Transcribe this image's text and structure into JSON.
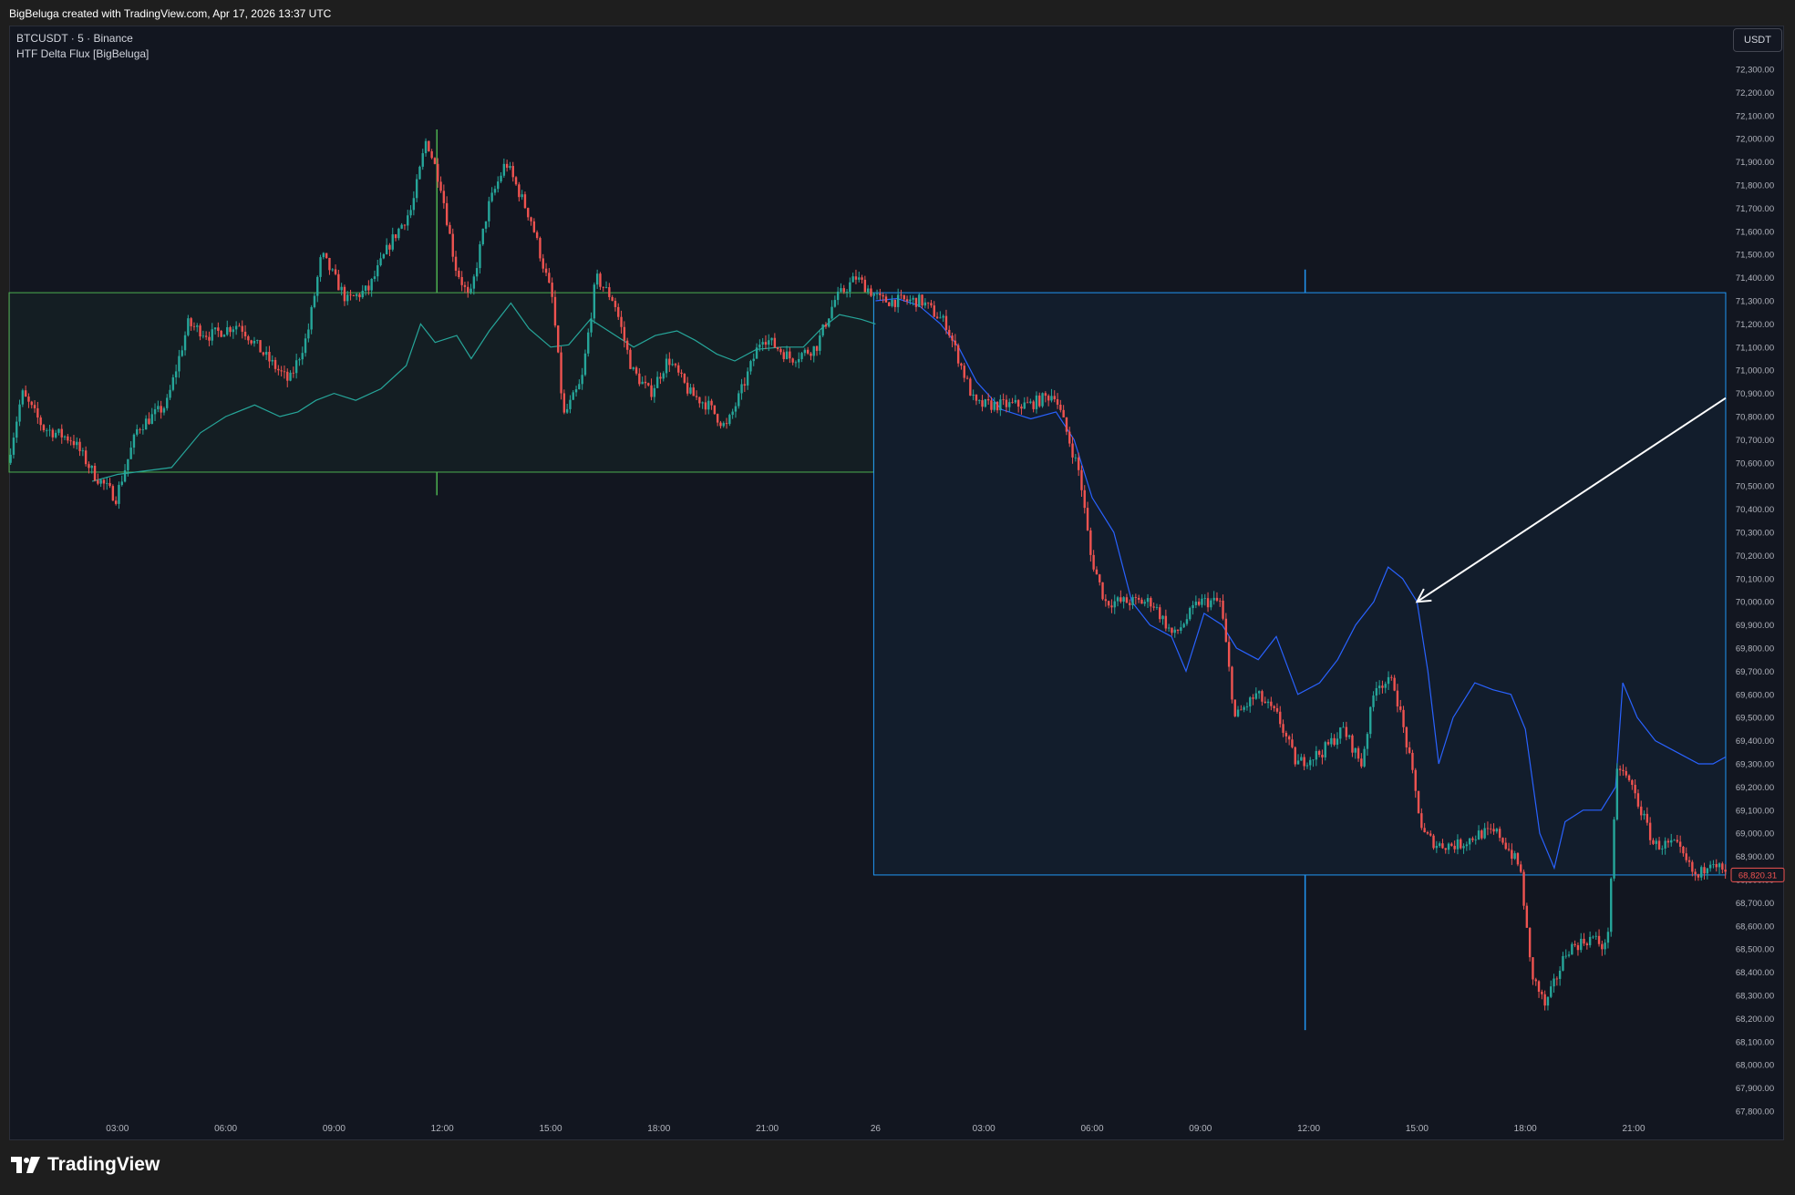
{
  "header": {
    "attribution": "BigBeluga created with TradingView.com, Apr 17, 2026 13:37 UTC"
  },
  "legend": {
    "symbol_line": "BTCUSDT · 5 · Binance",
    "indicator_line": "HTF Delta Flux [BigBeluga]"
  },
  "price_scale": {
    "unit_button": "USDT",
    "last_price_label": "68,820.31"
  },
  "footer": {
    "brand": "TradingView"
  },
  "colors": {
    "background": "#121620",
    "up_candle": "#26a69a",
    "down_candle": "#ef5350",
    "green_box": "#4caf50",
    "blue_box": "#2196f3",
    "delta_line_green": "#26a69a",
    "delta_line_blue": "#2962ff",
    "arrow": "#ffffff",
    "last_price": "#ef5350"
  },
  "chart_data": {
    "type": "candlestick",
    "symbol": "BTCUSDT",
    "interval": "5",
    "exchange": "Binance",
    "ylim": [
      67800,
      72300
    ],
    "y_ticks": [
      "72,300.00",
      "72,200.00",
      "72,100.00",
      "72,000.00",
      "71,900.00",
      "71,800.00",
      "71,700.00",
      "71,600.00",
      "71,500.00",
      "71,400.00",
      "71,300.00",
      "71,200.00",
      "71,100.00",
      "71,000.00",
      "70,900.00",
      "70,800.00",
      "70,700.00",
      "70,600.00",
      "70,500.00",
      "70,400.00",
      "70,300.00",
      "70,200.00",
      "70,100.00",
      "70,000.00",
      "69,900.00",
      "69,800.00",
      "69,700.00",
      "69,600.00",
      "69,500.00",
      "69,400.00",
      "69,300.00",
      "69,200.00",
      "69,100.00",
      "69,000.00",
      "68,900.00",
      "68,800.00",
      "68,700.00",
      "68,600.00",
      "68,500.00",
      "68,400.00",
      "68,300.00",
      "68,200.00",
      "68,100.00",
      "68,000.00",
      "67,900.00",
      "67,800.00"
    ],
    "x_ticks": [
      {
        "label": "03:00",
        "hours": 3
      },
      {
        "label": "06:00",
        "hours": 6
      },
      {
        "label": "09:00",
        "hours": 9
      },
      {
        "label": "12:00",
        "hours": 12
      },
      {
        "label": "15:00",
        "hours": 15
      },
      {
        "label": "18:00",
        "hours": 18
      },
      {
        "label": "21:00",
        "hours": 21
      },
      {
        "label": "26",
        "hours": 24
      },
      {
        "label": "03:00",
        "hours": 27
      },
      {
        "label": "06:00",
        "hours": 30
      },
      {
        "label": "09:00",
        "hours": 33
      },
      {
        "label": "12:00",
        "hours": 36
      },
      {
        "label": "15:00",
        "hours": 39
      },
      {
        "label": "18:00",
        "hours": 42
      },
      {
        "label": "21:00",
        "hours": 45
      }
    ],
    "x_range_hours": [
      0.0,
      47.55
    ],
    "price_path": [
      [
        0.0,
        70600
      ],
      [
        0.4,
        70900
      ],
      [
        1.0,
        70750
      ],
      [
        1.8,
        70700
      ],
      [
        2.4,
        70550
      ],
      [
        3.0,
        70450
      ],
      [
        3.6,
        70750
      ],
      [
        4.4,
        70850
      ],
      [
        5.0,
        71200
      ],
      [
        5.6,
        71150
      ],
      [
        6.4,
        71200
      ],
      [
        7.2,
        71050
      ],
      [
        7.8,
        70950
      ],
      [
        8.3,
        71150
      ],
      [
        8.7,
        71500
      ],
      [
        9.4,
        71300
      ],
      [
        10.0,
        71350
      ],
      [
        10.6,
        71550
      ],
      [
        11.2,
        71700
      ],
      [
        11.6,
        72000
      ],
      [
        12.0,
        71800
      ],
      [
        12.4,
        71450
      ],
      [
        12.8,
        71300
      ],
      [
        13.3,
        71700
      ],
      [
        13.8,
        71900
      ],
      [
        14.5,
        71650
      ],
      [
        15.1,
        71300
      ],
      [
        15.4,
        70800
      ],
      [
        15.9,
        70950
      ],
      [
        16.3,
        71400
      ],
      [
        16.8,
        71300
      ],
      [
        17.3,
        71000
      ],
      [
        17.8,
        70900
      ],
      [
        18.3,
        71050
      ],
      [
        18.9,
        70900
      ],
      [
        19.4,
        70850
      ],
      [
        19.9,
        70750
      ],
      [
        20.3,
        70900
      ],
      [
        20.9,
        71150
      ],
      [
        21.7,
        71050
      ],
      [
        22.4,
        71100
      ],
      [
        22.9,
        71300
      ],
      [
        23.5,
        71400
      ],
      [
        24.2,
        71300
      ],
      [
        24.8,
        71300
      ],
      [
        25.3,
        71300
      ],
      [
        26.0,
        71200
      ],
      [
        26.8,
        70850
      ],
      [
        27.6,
        70850
      ],
      [
        28.3,
        70850
      ],
      [
        29.0,
        70900
      ],
      [
        29.7,
        70550
      ],
      [
        30.0,
        70200
      ],
      [
        30.4,
        70000
      ],
      [
        31.0,
        70000
      ],
      [
        31.7,
        70000
      ],
      [
        32.3,
        69850
      ],
      [
        33.0,
        70000
      ],
      [
        33.6,
        70000
      ],
      [
        34.0,
        69500
      ],
      [
        34.6,
        69600
      ],
      [
        35.2,
        69500
      ],
      [
        35.7,
        69300
      ],
      [
        36.4,
        69350
      ],
      [
        37.0,
        69450
      ],
      [
        37.5,
        69300
      ],
      [
        37.9,
        69650
      ],
      [
        38.4,
        69650
      ],
      [
        38.8,
        69350
      ],
      [
        39.2,
        69000
      ],
      [
        39.6,
        68950
      ],
      [
        40.2,
        68950
      ],
      [
        40.8,
        69000
      ],
      [
        41.3,
        69000
      ],
      [
        41.9,
        68850
      ],
      [
        42.2,
        68400
      ],
      [
        42.6,
        68250
      ],
      [
        43.2,
        68500
      ],
      [
        43.9,
        68550
      ],
      [
        44.3,
        68500
      ],
      [
        44.6,
        69300
      ],
      [
        45.0,
        69200
      ],
      [
        45.6,
        68950
      ],
      [
        46.2,
        68950
      ],
      [
        46.8,
        68800
      ],
      [
        47.2,
        68900
      ],
      [
        47.55,
        68820
      ]
    ],
    "delta_flux_segments": [
      {
        "color": "green",
        "points": [
          [
            2.3,
            70520
          ],
          [
            3.0,
            70550
          ],
          [
            4.5,
            70580
          ],
          [
            5.3,
            70730
          ],
          [
            6.0,
            70800
          ],
          [
            6.8,
            70850
          ],
          [
            7.5,
            70800
          ],
          [
            8.0,
            70820
          ],
          [
            8.5,
            70870
          ],
          [
            9.0,
            70900
          ],
          [
            9.6,
            70870
          ],
          [
            10.3,
            70920
          ],
          [
            11.0,
            71020
          ],
          [
            11.4,
            71200
          ],
          [
            11.8,
            71120
          ],
          [
            12.4,
            71150
          ],
          [
            12.8,
            71050
          ],
          [
            13.3,
            71170
          ],
          [
            13.9,
            71290
          ],
          [
            14.4,
            71180
          ],
          [
            15.0,
            71100
          ],
          [
            15.5,
            71110
          ],
          [
            16.1,
            71220
          ],
          [
            16.8,
            71150
          ],
          [
            17.3,
            71100
          ],
          [
            17.9,
            71150
          ],
          [
            18.5,
            71170
          ],
          [
            19.0,
            71130
          ],
          [
            19.6,
            71070
          ],
          [
            20.1,
            71040
          ],
          [
            20.7,
            71090
          ],
          [
            21.4,
            71100
          ],
          [
            22.0,
            71100
          ],
          [
            22.5,
            71180
          ],
          [
            23.0,
            71240
          ],
          [
            23.6,
            71220
          ],
          [
            24.0,
            71200
          ]
        ]
      },
      {
        "color": "blue",
        "points": [
          [
            24.0,
            71300
          ],
          [
            24.6,
            71310
          ],
          [
            25.2,
            71280
          ],
          [
            25.8,
            71200
          ],
          [
            26.3,
            71100
          ],
          [
            26.8,
            70950
          ],
          [
            27.5,
            70830
          ],
          [
            28.3,
            70790
          ],
          [
            29.0,
            70820
          ],
          [
            29.5,
            70700
          ],
          [
            30.0,
            70450
          ],
          [
            30.6,
            70300
          ],
          [
            31.1,
            70000
          ],
          [
            31.6,
            69900
          ],
          [
            32.2,
            69850
          ],
          [
            32.6,
            69700
          ],
          [
            33.1,
            69950
          ],
          [
            33.6,
            69900
          ],
          [
            34.0,
            69800
          ],
          [
            34.6,
            69750
          ],
          [
            35.1,
            69850
          ],
          [
            35.7,
            69600
          ],
          [
            36.3,
            69650
          ],
          [
            36.8,
            69750
          ],
          [
            37.3,
            69900
          ],
          [
            37.8,
            70000
          ],
          [
            38.2,
            70150
          ],
          [
            38.6,
            70100
          ],
          [
            39.0,
            70000
          ],
          [
            39.3,
            69700
          ],
          [
            39.6,
            69300
          ],
          [
            40.0,
            69500
          ],
          [
            40.6,
            69650
          ],
          [
            41.1,
            69620
          ],
          [
            41.6,
            69600
          ],
          [
            42.0,
            69450
          ],
          [
            42.4,
            69000
          ],
          [
            42.8,
            68850
          ],
          [
            43.1,
            69050
          ],
          [
            43.6,
            69100
          ],
          [
            44.1,
            69100
          ],
          [
            44.5,
            69200
          ],
          [
            44.7,
            69650
          ],
          [
            45.1,
            69500
          ],
          [
            45.6,
            69400
          ],
          [
            46.2,
            69350
          ],
          [
            46.8,
            69300
          ],
          [
            47.2,
            69300
          ],
          [
            47.55,
            69330
          ]
        ]
      }
    ],
    "htf_boxes": [
      {
        "color": "green",
        "x_hours": [
          0.0,
          23.95
        ],
        "price": [
          70560,
          71335
        ],
        "wick_hours": 11.85,
        "wick_price": [
          70460,
          72040
        ]
      },
      {
        "color": "blue",
        "x_hours": [
          23.95,
          47.55
        ],
        "price": [
          68820,
          71335
        ],
        "wick_hours": 35.9,
        "wick_price": [
          68150,
          71435
        ]
      }
    ],
    "annotations": [
      {
        "type": "arrow",
        "from": [
          47.55,
          70880
        ],
        "to": [
          39.0,
          70000
        ]
      }
    ],
    "last_price": 68820.31
  }
}
